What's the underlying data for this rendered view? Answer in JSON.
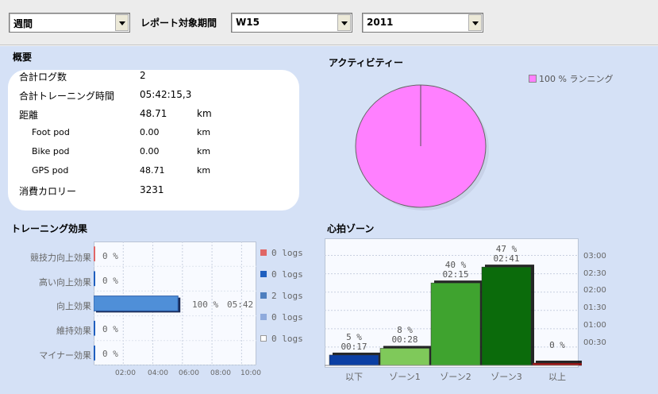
{
  "toolbar": {
    "period_type": "週間",
    "report_period_label": "レポート対象期間",
    "week": "W15",
    "year": "2011"
  },
  "summary": {
    "title": "概要",
    "rows": [
      {
        "label": "合計ログ数",
        "value": "2",
        "unit": ""
      },
      {
        "label": "合計トレーニング時間",
        "value": "05:42:15,3",
        "unit": ""
      },
      {
        "label": "距離",
        "value": "48.71",
        "unit": "km"
      },
      {
        "label": "Foot pod",
        "value": "0.00",
        "unit": "km"
      },
      {
        "label": "Bike pod",
        "value": "0.00",
        "unit": "km"
      },
      {
        "label": "GPS pod",
        "value": "48.71",
        "unit": "km"
      },
      {
        "label": "消費カロリー",
        "value": "3231",
        "unit": ""
      }
    ]
  },
  "activity": {
    "title": "アクティビティー",
    "legend": "100 % ランニング",
    "color": "#ff80ff"
  },
  "training_effect": {
    "title": "トレーニング効果",
    "categories": [
      "競技力向上効果",
      "高い向上効果",
      "向上効果",
      "維持効果",
      "マイナー効果"
    ],
    "percent_labels": [
      "0 %",
      "0 %",
      "100 %",
      "0 %",
      "0 %"
    ],
    "time_label": "05:42",
    "logs": [
      "0  logs",
      "0  logs",
      "2  logs",
      "0  logs",
      "0  logs"
    ],
    "log_colors": [
      "#e06666",
      "#1f5fbf",
      "#4f7fbf",
      "#8faadc",
      "#dddddd"
    ],
    "x_ticks": [
      "02:00",
      "04:00",
      "06:00",
      "08:00",
      "10:00"
    ]
  },
  "hr_zones": {
    "title": "心拍ゾーン",
    "y_ticks": [
      "03:00",
      "02:30",
      "02:00",
      "01:30",
      "01:00",
      "00:30"
    ]
  },
  "chart_data": [
    {
      "type": "bar",
      "title": "トレーニング効果",
      "orientation": "horizontal",
      "categories": [
        "競技力向上効果",
        "高い向上効果",
        "向上効果",
        "維持効果",
        "マイナー効果"
      ],
      "values": [
        0,
        0,
        100,
        0,
        0
      ],
      "value_unit": "%",
      "logs": [
        0,
        0,
        2,
        0,
        0
      ],
      "x_ticks": [
        "02:00",
        "04:00",
        "06:00",
        "08:00",
        "10:00"
      ],
      "xlim_hours": [
        0,
        11
      ],
      "bar_durations_hours": [
        0,
        0,
        5.7,
        0,
        0
      ],
      "grid": true
    },
    {
      "type": "bar",
      "title": "心拍ゾーン",
      "categories": [
        "以下",
        "ゾーン1",
        "ゾーン2",
        "ゾーン3",
        "以上"
      ],
      "percents": [
        5,
        8,
        40,
        47,
        0
      ],
      "durations": [
        "00:17",
        "00:28",
        "02:15",
        "02:41",
        ""
      ],
      "values_minutes": [
        17,
        28,
        135,
        161,
        0
      ],
      "colors": [
        "#0b3fa3",
        "#7fc95a",
        "#3fa32f",
        "#0b6b0b",
        "#a01010"
      ],
      "y_ticks": [
        "00:30",
        "01:00",
        "01:30",
        "02:00",
        "02:30",
        "03:00"
      ],
      "ylim_minutes": [
        0,
        195
      ],
      "grid": true
    },
    {
      "type": "pie",
      "title": "アクティビティー",
      "labels": [
        "ランニング"
      ],
      "values": [
        100
      ],
      "colors": [
        "#ff80ff"
      ]
    }
  ]
}
